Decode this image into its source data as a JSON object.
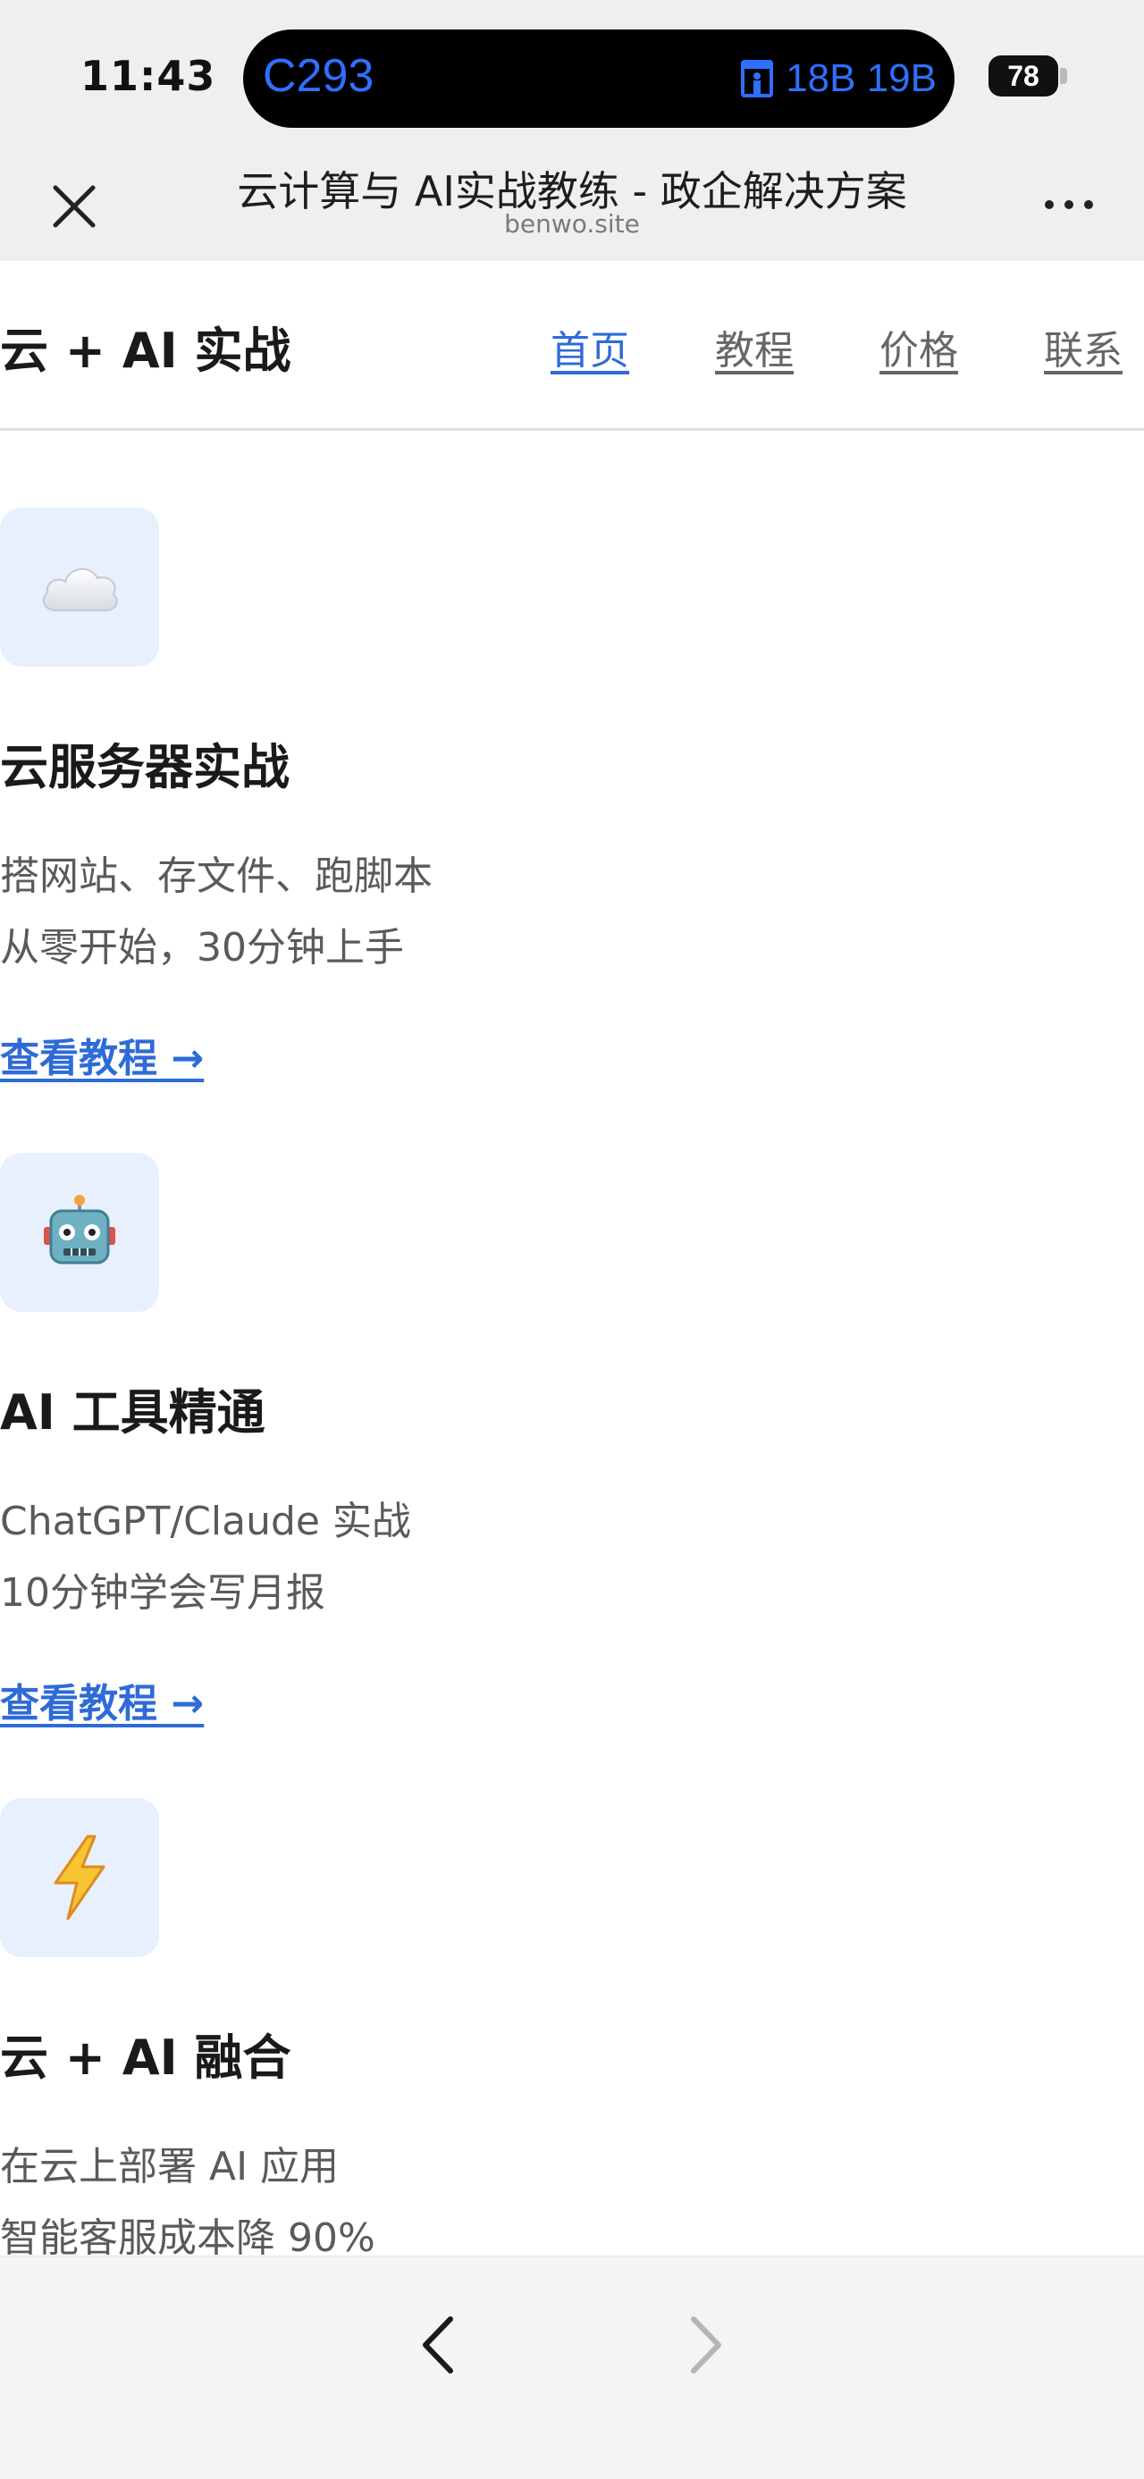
{
  "status_bar": {
    "time": "11:43",
    "island_route": "C293",
    "island_seats": "18B 19B",
    "battery": "78",
    "accent": "#2f6fff"
  },
  "browser": {
    "title": "云计算与 AI实战教练 - 政企解决方案",
    "domain": "benwo.site",
    "close_icon": "close-icon",
    "more_icon": "more-icon",
    "more_label": "..."
  },
  "site": {
    "logo": "云 + AI 实战",
    "nav": [
      {
        "label": "首页",
        "active": true
      },
      {
        "label": "教程",
        "active": false
      },
      {
        "label": "价格",
        "active": false
      },
      {
        "label": "联系",
        "active": false
      }
    ],
    "link_color": "#2e6bd8"
  },
  "cards": [
    {
      "icon": "cloud-icon",
      "title": "云服务器实战",
      "line1": "搭网站、存文件、跑脚本",
      "line2": "从零开始，30分钟上手",
      "link": "查看教程 →"
    },
    {
      "icon": "robot-icon",
      "title": "AI 工具精通",
      "line1": "ChatGPT/Claude 实战",
      "line2": "10分钟学会写月报",
      "link": "查看教程 →"
    },
    {
      "icon": "lightning-icon",
      "title": "云 + AI 融合",
      "line1": "在云上部署 AI 应用",
      "line2": "智能客服成本降 90%"
    }
  ],
  "toolbar": {
    "back_icon": "chevron-left-icon",
    "forward_icon": "chevron-right-icon"
  }
}
